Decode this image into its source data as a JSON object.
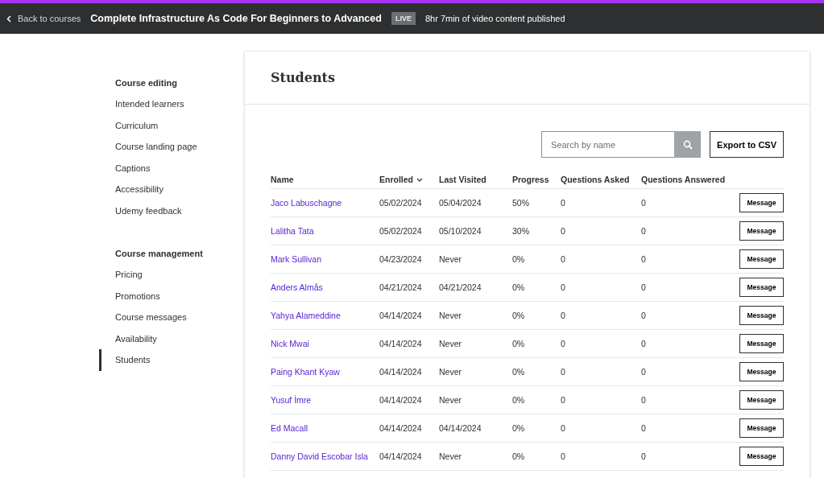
{
  "header": {
    "back_link": "Back to courses",
    "course_title": "Complete Infrastructure As Code For Beginners to Advanced",
    "status_badge": "LIVE",
    "summary": "8hr 7min of video content published"
  },
  "sidebar": {
    "sections": [
      {
        "title": "Course editing",
        "items": [
          {
            "label": "Intended learners",
            "selected": false
          },
          {
            "label": "Curriculum",
            "selected": false
          },
          {
            "label": "Course landing page",
            "selected": false
          },
          {
            "label": "Captions",
            "selected": false
          },
          {
            "label": "Accessibility",
            "selected": false
          },
          {
            "label": "Udemy feedback",
            "selected": false
          }
        ]
      },
      {
        "title": "Course management",
        "items": [
          {
            "label": "Pricing",
            "selected": false
          },
          {
            "label": "Promotions",
            "selected": false
          },
          {
            "label": "Course messages",
            "selected": false
          },
          {
            "label": "Availability",
            "selected": false
          },
          {
            "label": "Students",
            "selected": true
          }
        ]
      }
    ]
  },
  "page_title": "Students",
  "search": {
    "placeholder": "Search by name"
  },
  "export_button": "Export to CSV",
  "table": {
    "columns": [
      {
        "label": "Name",
        "sorted": false
      },
      {
        "label": "Enrolled",
        "sorted": true
      },
      {
        "label": "Last Visited",
        "sorted": false
      },
      {
        "label": "Progress",
        "sorted": false
      },
      {
        "label": "Questions Asked",
        "sorted": false
      },
      {
        "label": "Questions Answered",
        "sorted": false
      }
    ],
    "rows": [
      {
        "name": "Jaco Labuschagne",
        "enrolled": "05/02/2024",
        "last_visited": "05/04/2024",
        "progress": "50%",
        "asked": "0",
        "answered": "0",
        "action": "Message"
      },
      {
        "name": "Lalitha Tata",
        "enrolled": "05/02/2024",
        "last_visited": "05/10/2024",
        "progress": "30%",
        "asked": "0",
        "answered": "0",
        "action": "Message"
      },
      {
        "name": "Mark Sullivan",
        "enrolled": "04/23/2024",
        "last_visited": "Never",
        "progress": "0%",
        "asked": "0",
        "answered": "0",
        "action": "Message"
      },
      {
        "name": "Anders Almås",
        "enrolled": "04/21/2024",
        "last_visited": "04/21/2024",
        "progress": "0%",
        "asked": "0",
        "answered": "0",
        "action": "Message"
      },
      {
        "name": "Yahya Alameddine",
        "enrolled": "04/14/2024",
        "last_visited": "Never",
        "progress": "0%",
        "asked": "0",
        "answered": "0",
        "action": "Message"
      },
      {
        "name": "Nick Mwai",
        "enrolled": "04/14/2024",
        "last_visited": "Never",
        "progress": "0%",
        "asked": "0",
        "answered": "0",
        "action": "Message"
      },
      {
        "name": "Paing Khant Kyaw",
        "enrolled": "04/14/2024",
        "last_visited": "Never",
        "progress": "0%",
        "asked": "0",
        "answered": "0",
        "action": "Message"
      },
      {
        "name": "Yusuf İmre",
        "enrolled": "04/14/2024",
        "last_visited": "Never",
        "progress": "0%",
        "asked": "0",
        "answered": "0",
        "action": "Message"
      },
      {
        "name": "Ed Macall",
        "enrolled": "04/14/2024",
        "last_visited": "04/14/2024",
        "progress": "0%",
        "asked": "0",
        "answered": "0",
        "action": "Message"
      },
      {
        "name": "Danny David Escobar Isla",
        "enrolled": "04/14/2024",
        "last_visited": "Never",
        "progress": "0%",
        "asked": "0",
        "answered": "0",
        "action": "Message"
      }
    ]
  }
}
